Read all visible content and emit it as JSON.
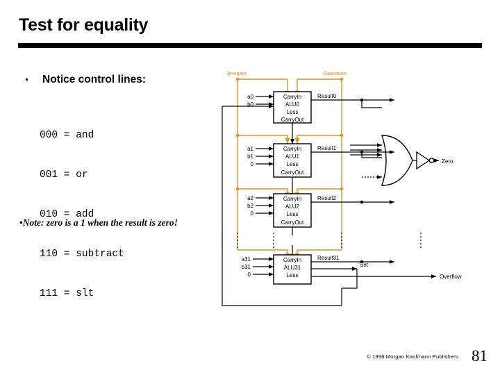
{
  "slide": {
    "title": "Test for equality",
    "bullet": {
      "marker": "•",
      "label": "Notice control lines:"
    },
    "control_lines": [
      "000 = and",
      "001 = or",
      "010 = add",
      "110 = subtract",
      "111 = slt"
    ],
    "note": {
      "marker": "•",
      "text": "Note:  zero is a 1 when the result is zero!"
    },
    "footer": {
      "copyright": "© 1998 Morgan Kaufmann Publishers",
      "page_number": "81"
    }
  },
  "figure": {
    "name": "32-bit-alu-with-zero-detection",
    "colors": {
      "control_wire": "#E0902F",
      "signal_wire": "#000000",
      "block_fill": "#FFFFFF",
      "block_stroke": "#000000"
    },
    "control_labels": [
      {
        "name": "bnegate-label",
        "text": "Bnegate"
      },
      {
        "name": "operation-label",
        "text": "Operation"
      }
    ],
    "alu_blocks": [
      {
        "name": "alu0",
        "title": "ALU0",
        "ports": [
          "CarryIn",
          "ALU0",
          "Less",
          "CarryOut"
        ],
        "inputs": [
          "a0",
          "b0"
        ],
        "output": "Result0"
      },
      {
        "name": "alu1",
        "title": "ALU1",
        "ports": [
          "CarryIn",
          "ALU1",
          "Less",
          "CarryOut"
        ],
        "inputs": [
          "a1",
          "b1",
          "0"
        ],
        "output": "Result1"
      },
      {
        "name": "alu2",
        "title": "ALU2",
        "ports": [
          "CarryIn",
          "ALU2",
          "Less",
          "CarryOut"
        ],
        "inputs": [
          "a2",
          "b2",
          "0"
        ],
        "output": "Result2"
      },
      {
        "name": "alu31",
        "title": "ALU31",
        "ports": [
          "CarryIn",
          "ALU31",
          "Less"
        ],
        "inputs": [
          "a31",
          "b31",
          "0"
        ],
        "output": "Result31",
        "extra_output": "Set"
      }
    ],
    "outputs": [
      {
        "name": "zero-output",
        "text": "Zero"
      },
      {
        "name": "set-output",
        "text": "Set"
      },
      {
        "name": "overflow-output",
        "text": "Overflow"
      }
    ],
    "gates": [
      {
        "name": "nor-gate",
        "kind": "or-gate-with-inverter",
        "produces": "Zero"
      }
    ],
    "ellipsis": "⋮"
  }
}
